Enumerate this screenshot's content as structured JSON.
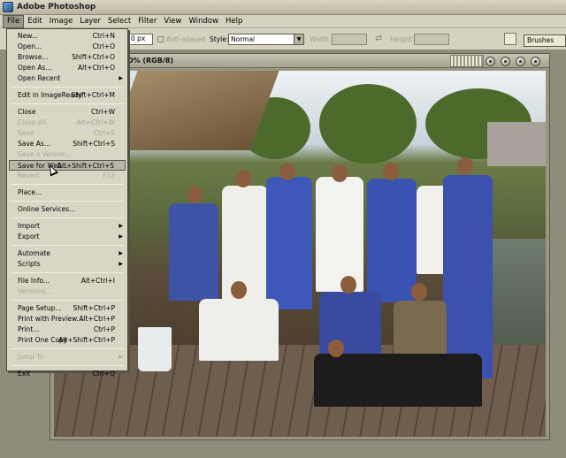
{
  "window": {
    "title": "Adobe Photoshop"
  },
  "menubar": [
    "File",
    "Edit",
    "Image",
    "Layer",
    "Select",
    "Filter",
    "View",
    "Window",
    "Help"
  ],
  "options": {
    "feather_value": "0 px",
    "anti_aliased_label": "Anti-aliased",
    "style_label": "Style:",
    "style_value": "Normal",
    "width_label": "Width:",
    "height_label": "Height:",
    "brushes_tab": "Brushes"
  },
  "document": {
    "title": "0% (RGB/8)"
  },
  "file_menu": {
    "items": [
      {
        "label": "New...",
        "shortcut": "Ctrl+N",
        "enabled": true
      },
      {
        "label": "Open...",
        "shortcut": "Ctrl+O",
        "enabled": true
      },
      {
        "label": "Browse...",
        "shortcut": "Shift+Ctrl+O",
        "enabled": true
      },
      {
        "label": "Open As...",
        "shortcut": "Alt+Ctrl+O",
        "enabled": true
      },
      {
        "label": "Open Recent",
        "shortcut": "",
        "enabled": true,
        "submenu": true
      },
      {
        "sep": true
      },
      {
        "label": "Edit in ImageReady",
        "shortcut": "Shift+Ctrl+M",
        "enabled": true
      },
      {
        "sep": true
      },
      {
        "label": "Close",
        "shortcut": "Ctrl+W",
        "enabled": true
      },
      {
        "label": "Close All",
        "shortcut": "Alt+Ctrl+W",
        "enabled": false
      },
      {
        "label": "Save",
        "shortcut": "Ctrl+S",
        "enabled": false
      },
      {
        "label": "Save As...",
        "shortcut": "Shift+Ctrl+S",
        "enabled": true
      },
      {
        "label": "Save a Version...",
        "shortcut": "",
        "enabled": false
      },
      {
        "label": "Save for Web...",
        "shortcut": "Alt+Shift+Ctrl+S",
        "enabled": true,
        "highlighted": true
      },
      {
        "label": "Revert",
        "shortcut": "F12",
        "enabled": false
      },
      {
        "sep": true
      },
      {
        "label": "Place...",
        "shortcut": "",
        "enabled": true
      },
      {
        "sep": true
      },
      {
        "label": "Online Services...",
        "shortcut": "",
        "enabled": true
      },
      {
        "sep": true
      },
      {
        "label": "Import",
        "shortcut": "",
        "enabled": true,
        "submenu": true
      },
      {
        "label": "Export",
        "shortcut": "",
        "enabled": true,
        "submenu": true
      },
      {
        "sep": true
      },
      {
        "label": "Automate",
        "shortcut": "",
        "enabled": true,
        "submenu": true
      },
      {
        "label": "Scripts",
        "shortcut": "",
        "enabled": true,
        "submenu": true
      },
      {
        "sep": true
      },
      {
        "label": "File Info...",
        "shortcut": "Alt+Ctrl+I",
        "enabled": true
      },
      {
        "label": "Versions...",
        "shortcut": "",
        "enabled": false
      },
      {
        "sep": true
      },
      {
        "label": "Page Setup...",
        "shortcut": "Shift+Ctrl+P",
        "enabled": true
      },
      {
        "label": "Print with Preview...",
        "shortcut": "Alt+Ctrl+P",
        "enabled": true
      },
      {
        "label": "Print...",
        "shortcut": "Ctrl+P",
        "enabled": true
      },
      {
        "label": "Print One Copy",
        "shortcut": "Alt+Shift+Ctrl+P",
        "enabled": true
      },
      {
        "sep": true
      },
      {
        "label": "Jump To",
        "shortcut": "",
        "enabled": false,
        "submenu": true
      },
      {
        "sep": true
      },
      {
        "label": "Exit",
        "shortcut": "Ctrl+Q",
        "enabled": true
      }
    ]
  }
}
